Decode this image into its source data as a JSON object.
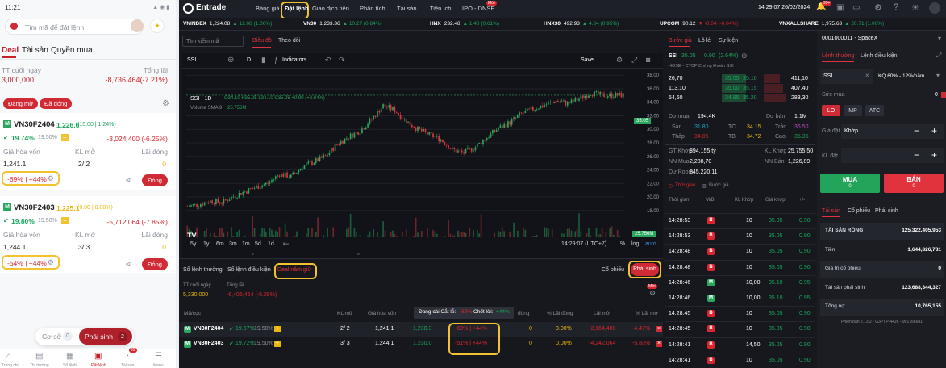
{
  "mobile": {
    "status_time": "11:21",
    "search_placeholder": "Tìm mã để đặt lệnh",
    "tabs": [
      "Deal",
      "Tài sản",
      "Quyền mua"
    ],
    "nav_last_label": "TT cuối ngày",
    "nav_last_value": "3,000,000",
    "total_pl_label": "Tổng lãi",
    "total_pl_value": "-8,736,464(-7.21%)",
    "filter_open": "Đang mở",
    "filter_closed": "Đã đóng",
    "positions": [
      {
        "badge": "M",
        "code": "VN30F2404",
        "price": "1,226.0",
        "change": "(15.00 | 1.24%)",
        "ratio": "19.74%",
        "ratio_sub": "19.50%",
        "pl": "-3,024,400 (-6.25%)",
        "cost_label": "Giá hòa vốn",
        "open_label": "KL mở",
        "closed_label": "Lãi đóng",
        "cost": "1,241.1",
        "open": "2/ 2",
        "closed": "0",
        "sltp": "-69% | +44%",
        "close_btn": "Đóng"
      },
      {
        "badge": "M",
        "code": "VN30F2403",
        "price": "1,225.1",
        "change": "(0.00 | 0.00%)",
        "ratio": "19.80%",
        "ratio_sub": "19.50%",
        "pl": "-5,712,064 (-7.85%)",
        "cost_label": "Giá hòa vốn",
        "open_label": "KL mở",
        "closed_label": "Lãi đóng",
        "cost": "1,244.1",
        "open": "3/ 3",
        "closed": "0",
        "sltp": "-54% | +44%",
        "close_btn": "Đóng"
      }
    ],
    "toggle_base": "Cơ sở",
    "toggle_base_count": "0",
    "toggle_deriv": "Phái sinh",
    "toggle_deriv_count": "2",
    "bottom_nav": [
      "Trang chủ",
      "Thị trường",
      "Sổ lệnh",
      "Đặt lệnh",
      "Tài sản",
      "Menu"
    ],
    "badge_count": "99"
  },
  "desktop": {
    "brand": "Entrade",
    "nav": [
      "Bảng giá",
      "Đặt lệnh",
      "Giao dịch tiền",
      "Phân tích",
      "Tài sản",
      "Tiện ích",
      "IPO - DNSE"
    ],
    "nav_new": "Mới",
    "clock": "14:29:07 26/02/2024",
    "bell_count": "99+",
    "indices": [
      {
        "name": "VNINDEX",
        "value": "1,224.08",
        "chg": "▲ 12.08 (1.00%)",
        "c": "green"
      },
      {
        "name": "VN30",
        "value": "1,233.36",
        "chg": "▲ 10.27 (0.84%)",
        "c": "green"
      },
      {
        "name": "HNX",
        "value": "232.48",
        "chg": "▲ 1.40 (0.61%)",
        "c": "green"
      },
      {
        "name": "HNX30",
        "value": "492.93",
        "chg": "▲ 4.64 (0.95%)",
        "c": "green"
      },
      {
        "name": "UPCOM",
        "value": "90.12",
        "chg": "▼ -0.04 (-0.04%)",
        "c": "red"
      },
      {
        "name": "VNXALLSHARE",
        "value": "1,975.63",
        "chg": "▲ 20.71 (1.06%)",
        "c": "green"
      }
    ],
    "chart_panel": {
      "search_placeholder": "Tìm kiếm mã",
      "tab_chart": "Biểu đồ",
      "tab_follow": "Theo dõi",
      "symbol": "SSI",
      "interval": "D",
      "indicators": "Indicators",
      "save": "Save",
      "legend": "SSI · 1D",
      "ohlc": "O34.10 H35.25 L34.10 C35.05 +0.90 (+2.64%)",
      "vol_label": "Volume SMA 9",
      "vol_value": "25.756M",
      "ranges": [
        "5y",
        "1y",
        "6m",
        "3m",
        "1m",
        "5d",
        "1d"
      ],
      "time_zone": "14:29:07 (UTC+7)",
      "pct": "%",
      "log": "log",
      "auto": "auto",
      "price_tag": "35.05",
      "vol_tag": "25.756M",
      "watermark": "TV"
    },
    "price_panel": {
      "tabs": [
        "Bước giá",
        "Lô lẻ",
        "Sự kiện"
      ],
      "symbol": "SSI",
      "price": "35.05",
      "chg": "0.90",
      "pct": "(2.64%)",
      "company": "HOSE - CTCP Chứng khoán SSI",
      "book": [
        [
          "26,70",
          "35.05",
          "35.10",
          "411,10"
        ],
        [
          "113,10",
          "35.00",
          "35.15",
          "407,40"
        ],
        [
          "54,60",
          "34.95",
          "35.20",
          "283,30"
        ]
      ],
      "buy_vol_label": "Dư mua:",
      "buy_vol": "194.4K",
      "sell_vol_label": "Dư bán:",
      "sell_vol": "1.1M",
      "stats": [
        [
          "Sàn",
          "31.80",
          "TC",
          "34.15",
          "Trần",
          "36.50"
        ],
        [
          "Thấp",
          "34.05",
          "TB",
          "34.72",
          "Cao",
          "35.35"
        ]
      ],
      "info": [
        [
          "GT Khớp",
          "894.155 tỷ",
          "KL Khớp",
          "25,755,50"
        ],
        [
          "NN Mua",
          "2,288,70",
          "NN Bán",
          "1,226,89"
        ],
        [
          "Dư Room",
          "845,220,11",
          "",
          ""
        ]
      ],
      "sub_tabs": [
        "Thời gian",
        "Bước giá"
      ],
      "trade_headers": [
        "Thời gian",
        "M/B",
        "KL Khớp",
        "Giá khớp",
        "+/-"
      ],
      "trades": [
        [
          "14:28:53",
          "B",
          "10",
          "35.05",
          "0.90"
        ],
        [
          "14:28:53",
          "B",
          "10",
          "35.05",
          "0.90"
        ],
        [
          "14:28:48",
          "B",
          "10",
          "35.05",
          "0.90"
        ],
        [
          "14:28:48",
          "B",
          "10",
          "35.05",
          "0.90"
        ],
        [
          "14:28:46",
          "M",
          "10,00",
          "35.10",
          "0.95"
        ],
        [
          "14:28:46",
          "M",
          "10,00",
          "35.10",
          "0.95"
        ],
        [
          "14:28:45",
          "B",
          "10",
          "35.05",
          "0.90"
        ],
        [
          "14:28:45",
          "B",
          "10",
          "35.05",
          "0.90"
        ],
        [
          "14:28:41",
          "B",
          "14,50",
          "35.05",
          "0.90"
        ],
        [
          "14:28:41",
          "B",
          "10",
          "35.05",
          "0.90"
        ]
      ]
    },
    "order_panel": {
      "account": "0001000011 - SpaceX",
      "tab_normal": "Lệnh thường",
      "tab_cond": "Lệnh điều kiện",
      "symbol": "SSI",
      "kq": "KQ 60% - 12%/năm",
      "power_label": "Sức mua",
      "power_value": "0",
      "types": [
        "LO",
        "MP",
        "ATC"
      ],
      "price_label": "Giá đặt",
      "price_val": "Khớp",
      "qty_label": "KL đặt",
      "buy": "MUA",
      "buy_sub": "0",
      "sell": "BÁN",
      "sell_sub": "0",
      "asset_tabs": [
        "Tài sản",
        "Cổ phiếu",
        "Phái sinh"
      ],
      "assets": [
        [
          "TÀI SẢN RÒNG",
          "125,322,405,953"
        ],
        [
          "Tiền",
          "1,644,826,781"
        ],
        [
          "Giá trị cổ phiếu",
          "0"
        ],
        [
          "Tài sản phái sinh",
          "123,688,344,327"
        ],
        [
          "Tổng nợ",
          "10,765,155"
        ]
      ],
      "version": "Phiên bản 2.13.2 - G3PTP-4426 - 901756681"
    },
    "positions_panel": {
      "tabs": [
        "Sổ lệnh thường",
        "Sổ lệnh điều kiện",
        "Deal nắm giữ"
      ],
      "btn_stock": "Cổ phiếu",
      "btn_deriv": "Phái sinh",
      "nav_label": "TT cuối ngày",
      "nav_value": "5,330,000",
      "pl_label": "Tổng lãi",
      "pl_value": "-6,406,464 (-5.29%)",
      "headers": [
        "Mã/cọc",
        "KL mở",
        "Giá hòa vốn",
        "Giá",
        "đóng",
        "% Lãi đóng",
        "Lãi mở",
        "% Lãi mở"
      ],
      "tooltip_label": "Đang cài Cắt lỗ:",
      "tooltip_sl": "-69%",
      "tooltip_tp_label": "Chốt lời:",
      "tooltip_tp": "+44%",
      "rows": [
        {
          "code": "VN30F2404",
          "ratio": "19.67%",
          "ratio_sub": "19.50%",
          "open": "2/ 2",
          "cost": "1,241.1",
          "price": "1,230.3",
          "sltp": "-69% | +44%",
          "closed": "0",
          "closed_pct": "0.00%",
          "pl": "-2,164,400",
          "pl_pct": "-4.47%"
        },
        {
          "code": "VN30F2403",
          "ratio": "19.72%",
          "ratio_sub": "19.50%",
          "open": "3/ 3",
          "cost": "1,244.1",
          "price": "1,230.0",
          "sltp": "-51% | +44%",
          "closed": "0",
          "closed_pct": "0.00%",
          "pl": "-4,242,064",
          "pl_pct": "-5.83%"
        }
      ]
    }
  },
  "chart_data": {
    "type": "candlestick",
    "symbol": "SSI",
    "x_ticks": [
      "Mar",
      "May",
      "Jun",
      "Aug",
      "Sep",
      "Nov",
      "2024",
      "Feb",
      "Mar"
    ],
    "y_ticks": [
      18,
      20,
      22,
      24,
      26,
      28,
      30,
      32,
      34,
      36,
      38
    ],
    "ylim": [
      17.5,
      38.5
    ],
    "last_close": 35.05,
    "approx_close_path": [
      18.6,
      18.9,
      19.4,
      19.2,
      20.1,
      20.8,
      21.5,
      22.0,
      23.4,
      23.0,
      24.5,
      25.2,
      26.0,
      27.8,
      28.9,
      29.8,
      31.5,
      33.5,
      32.8,
      31.2,
      30.0,
      29.2,
      28.5,
      27.0,
      26.5,
      27.4,
      28.8,
      30.2,
      31.0,
      32.3,
      33.0,
      33.6,
      34.2,
      33.8,
      34.5,
      35.4,
      35.0,
      35.05
    ]
  }
}
